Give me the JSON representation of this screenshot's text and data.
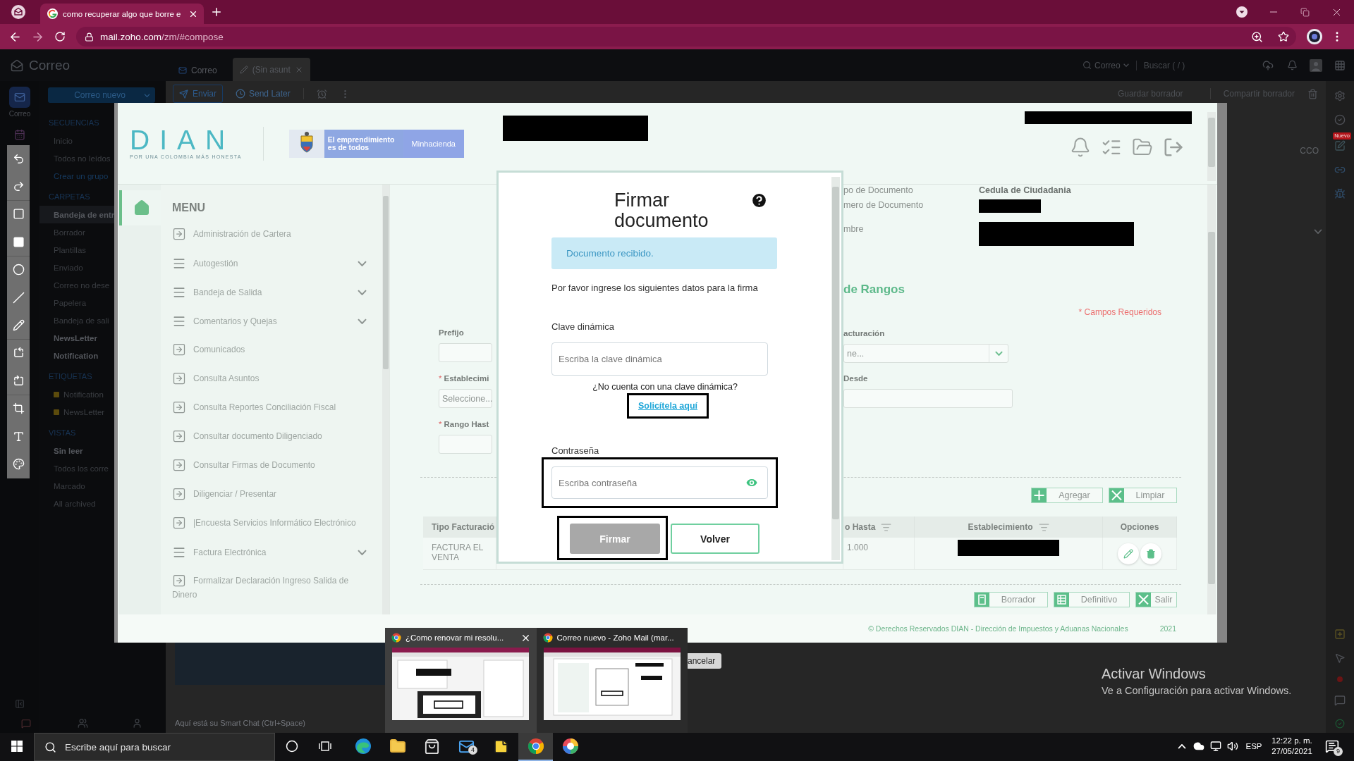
{
  "browser": {
    "tabs": [
      {
        "title": "como recuperar algo que borre e",
        "selected": true
      }
    ],
    "address": {
      "host": "mail.zoho.com",
      "path": "/zm/#compose"
    }
  },
  "zoho": {
    "app_title": "Correo",
    "tabs": [
      {
        "label": "Correo",
        "kind": "mail",
        "selected": false
      },
      {
        "label": "(Sin asunt",
        "kind": "draft",
        "selected": true
      }
    ],
    "search": {
      "scope": "Correo",
      "placeholder": "Buscar ( / )"
    },
    "rail": [
      {
        "kind": "mail",
        "label": "Correo",
        "selected": true
      },
      {
        "kind": "calendar",
        "selected": false
      }
    ],
    "new_mail_button": "Correo nuevo",
    "sections": [
      {
        "heading": "SECUENCIAS",
        "items": [
          {
            "label": "Inicio",
            "kind": "folder",
            "unread": false,
            "selected": false
          },
          {
            "label": "Todos no leídos",
            "kind": "folder",
            "unread": false,
            "selected": false
          },
          {
            "label": "Crear un grupo",
            "kind": "link",
            "unread": false,
            "selected": false
          }
        ]
      },
      {
        "heading": "CARPETAS",
        "items": [
          {
            "label": "Bandeja de entr",
            "kind": "folder",
            "unread": true,
            "selected": true
          },
          {
            "label": "Borrador",
            "kind": "folder",
            "unread": false,
            "selected": false
          },
          {
            "label": "Plantillas",
            "kind": "folder",
            "unread": false,
            "selected": false
          },
          {
            "label": "Enviado",
            "kind": "folder",
            "unread": false,
            "selected": false
          },
          {
            "label": "Correo no dese",
            "kind": "folder",
            "unread": false,
            "selected": false
          },
          {
            "label": "Papelera",
            "kind": "folder",
            "unread": false,
            "selected": false
          },
          {
            "label": "Bandeja de sali",
            "kind": "folder",
            "unread": false,
            "selected": false
          },
          {
            "label": "NewsLetter",
            "kind": "folder",
            "unread": true,
            "selected": false
          },
          {
            "label": "Notification",
            "kind": "folder",
            "unread": true,
            "selected": false
          }
        ]
      },
      {
        "heading": "ETIQUETAS",
        "items": [
          {
            "label": "Notification",
            "kind": "tag",
            "color": "#5c4b0c",
            "unread": false,
            "selected": false
          },
          {
            "label": "NewsLetter",
            "kind": "tag",
            "color": "#5c4b0c",
            "unread": false,
            "selected": false
          }
        ]
      },
      {
        "heading": "VISTAS",
        "items": [
          {
            "label": "Sin leer",
            "kind": "folder",
            "unread": true,
            "selected": false
          },
          {
            "label": "Todos los corre",
            "kind": "folder",
            "unread": false,
            "selected": false
          },
          {
            "label": "Marcado",
            "kind": "folder",
            "unread": false,
            "selected": false
          },
          {
            "label": "All archived",
            "kind": "folder",
            "unread": false,
            "selected": false
          }
        ]
      }
    ],
    "compose_toolbar": {
      "send": "Enviar",
      "send_later": "Send Later",
      "save_draft": "Guardar borrador",
      "share_draft": "Compartir borrador"
    },
    "bcc_label": "CCO",
    "new_badge": "Nuevo",
    "cancel_button": "ancelar",
    "smart_chat_hint": "Aquí está su Smart Chat (Ctrl+Space)"
  },
  "dian": {
    "logo": "DIAN",
    "logo_tagline": "POR UNA COLOMBIA MÁS HONESTA",
    "banner": {
      "slogan": "El emprendimiento es de todos",
      "ministry": "Minhacienda"
    },
    "menu_title": "MENU",
    "menu": [
      {
        "label": "Administración de Cartera",
        "kind": "link"
      },
      {
        "label": "Autogestión",
        "kind": "group"
      },
      {
        "label": "Bandeja de Salida",
        "kind": "group"
      },
      {
        "label": "Comentarios y Quejas",
        "kind": "group"
      },
      {
        "label": "Comunicados",
        "kind": "link"
      },
      {
        "label": "Consulta Asuntos",
        "kind": "link"
      },
      {
        "label": "Consulta Reportes Conciliación Fiscal",
        "kind": "link"
      },
      {
        "label": "Consultar documento Diligenciado",
        "kind": "link"
      },
      {
        "label": "Consultar Firmas de Documento",
        "kind": "link"
      },
      {
        "label": "Diligenciar / Presentar",
        "kind": "link"
      },
      {
        "label": "|Encuesta Servicios Informático Electrónico",
        "kind": "link"
      },
      {
        "label": "Factura Electrónica",
        "kind": "group"
      },
      {
        "label": "Formalizar Declaración Ingreso Salida de Dinero",
        "kind": "link"
      }
    ],
    "profile": [
      {
        "label": "po de Documento",
        "kind": "text",
        "value": "Cedula de Ciudadania"
      },
      {
        "label": "mero de Documento",
        "kind": "redacted"
      },
      {
        "label": "mbre",
        "kind": "redacted"
      }
    ],
    "section_title": "de Rangos",
    "required_note": "* Campos Requeridos",
    "form_left": [
      {
        "label": "Prefijo",
        "kind": "input"
      },
      {
        "label": "Establecimi",
        "marker": "*",
        "kind": "select",
        "value": "Seleccione..."
      },
      {
        "label": "Rango Hast",
        "marker": "*",
        "kind": "input"
      }
    ],
    "form_right": [
      {
        "label": "acturación",
        "kind": "select",
        "value": "ne..."
      },
      {
        "label": "Desde",
        "kind": "input"
      }
    ],
    "actions": [
      {
        "label": "Agregar",
        "kind": "add"
      },
      {
        "label": "Limpiar",
        "kind": "clear"
      }
    ],
    "table": {
      "columns": [
        {
          "label": "Tipo Facturació",
          "sortable": false
        },
        {
          "label": "o Hasta",
          "sortable": true
        },
        {
          "label": "Establecimiento",
          "sortable": true
        },
        {
          "label": "Opciones",
          "sortable": false
        }
      ],
      "rows": [
        {
          "cells": [
            {
              "kind": "text",
              "lines": [
                "FACTURA EL",
                "VENTA"
              ]
            },
            {
              "kind": "text",
              "lines": [
                "1.000"
              ]
            },
            {
              "kind": "redacted"
            },
            {
              "kind": "actions"
            }
          ]
        }
      ]
    },
    "footer_buttons": [
      {
        "label": "Borrador",
        "kind": "draft"
      },
      {
        "label": "Definitivo",
        "kind": "final"
      },
      {
        "label": "Salir",
        "kind": "exit"
      }
    ],
    "copyright": "© Derechos Reservados DIAN - Dirección de Impuestos y Aduanas Nacionales",
    "year": "2021",
    "modal": {
      "title": "Firmar documento",
      "alert": "Documento recibido.",
      "intro": "Por favor ingrese los siguientes datos para la firma",
      "key_field": {
        "label": "Clave dinámica",
        "placeholder": "Escriba la clave dinámica",
        "highlighted": false
      },
      "help_question": "¿No cuenta con una clave dinámica?",
      "help_link": {
        "label": "Solicítela aquí",
        "highlighted": true
      },
      "password_field": {
        "label": "Contraseña",
        "placeholder": "Escriba contraseña",
        "highlighted": true
      },
      "buttons": [
        {
          "label": "Firmar",
          "kind": "primary",
          "disabled": true,
          "highlighted": true
        },
        {
          "label": "Volver",
          "kind": "secondary",
          "disabled": false,
          "highlighted": false
        }
      ]
    }
  },
  "taskbar_previews": [
    {
      "title": "¿Como renovar mi resolu...",
      "hovered": true
    },
    {
      "title": "Correo nuevo - Zoho Mail (mar...",
      "hovered": false
    }
  ],
  "activation_notice": {
    "title": "Activar Windows",
    "subtitle": "Ve a Configuración para activar Windows."
  },
  "taskbar": {
    "search_placeholder": "Escribe aquí para buscar",
    "apps": [
      {
        "kind": "swirl",
        "selected": false
      },
      {
        "kind": "folder",
        "selected": false
      },
      {
        "kind": "bag",
        "selected": false
      },
      {
        "kind": "mail",
        "badge": "4",
        "selected": false
      },
      {
        "kind": "note",
        "selected": false
      },
      {
        "kind": "ring",
        "selected": true
      },
      {
        "kind": "wheel",
        "selected": false
      }
    ],
    "language": "ESP",
    "time": "12:22 p. m.",
    "date": "27/05/2021",
    "notifications": "9"
  }
}
